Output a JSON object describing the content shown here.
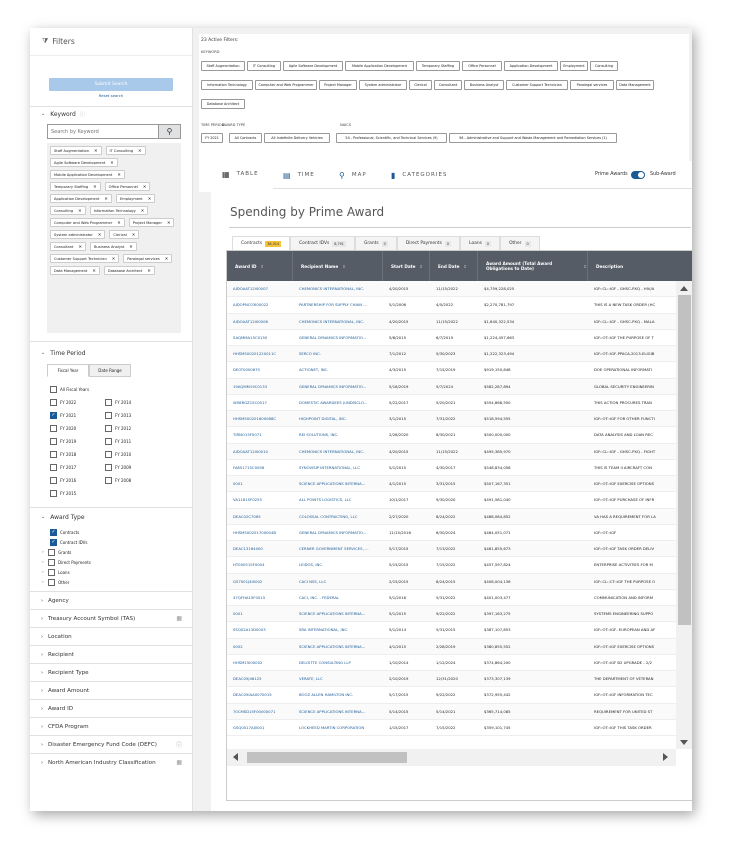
{
  "sidebar": {
    "title": "Filters",
    "submit_label": "Submit Search",
    "reset_label": "Reset search",
    "keyword": {
      "title": "Keyword",
      "placeholder": "Search by Keyword",
      "chips": [
        "Staff Augmentation",
        "IT Consulting",
        "Agile Software Development",
        "Mobile Application Development",
        "Temporary Staffing",
        "Office Personnel",
        "Application Development",
        "Employment",
        "Consulting",
        "Information Technology",
        "Computer and Web Programmer",
        "Project Manager",
        "System administrator",
        "Clerical",
        "Consultant",
        "Business Analyst",
        "Customer Support Technician",
        "Paralegal services",
        "Data Management",
        "Database Architect"
      ]
    },
    "time_period": {
      "title": "Time Period",
      "tab_fiscal": "Fiscal Year",
      "tab_range": "Date Range",
      "all_label": "All Fiscal Years",
      "years_left": [
        "FY 2022",
        "FY 2021",
        "FY 2020",
        "FY 2019",
        "FY 2018",
        "FY 2017",
        "FY 2016",
        "FY 2015"
      ],
      "years_right": [
        "FY 2014",
        "FY 2013",
        "FY 2012",
        "FY 2011",
        "FY 2010",
        "FY 2009",
        "FY 2008"
      ]
    },
    "award_type": {
      "title": "Award Type",
      "items": [
        "Contracts",
        "Contract IDVs",
        "Grants",
        "Direct Payments",
        "Loans",
        "Other"
      ]
    },
    "collapsed": [
      "Agency",
      "Treasury Account Symbol (TAS)",
      "Location",
      "Recipient",
      "Recipient Type",
      "Award Amount",
      "Award ID",
      "CFDA Program",
      "Disaster Emergency Fund Code (DEFC)",
      "North American Industry Classification"
    ]
  },
  "active_filters": {
    "title": "23 Active Filters:",
    "keyword_label": "KEYWORD",
    "row1": [
      "Staff Augmentation",
      "IT Consulting",
      "Agile Software Development",
      "Mobile Application Development",
      "Temporary Staffing",
      "Office Personnel",
      "Application Development",
      "Employment",
      "Consulting"
    ],
    "row2": [
      "Information Technology",
      "Computer and Web Programmer",
      "Project Manager",
      "System administrator",
      "Clerical",
      "Consultant",
      "Business Analyst",
      "Customer Support Technician",
      "Paralegal services",
      "Data Management"
    ],
    "row3": [
      "Database Architect"
    ],
    "time_label": "TIME PERIOD",
    "award_label": "AWARD TYPE",
    "naics_label": "NAICS",
    "time_chips": [
      "FY 2021"
    ],
    "award_chips": [
      "All Contracts",
      "All Indefinite Delivery Vehicles"
    ],
    "naics_chips": [
      "54 - Professional, Scientific, and Technical Services (9)",
      "56 - Administrative and Support and Waste Management and Remediation Services (1)"
    ]
  },
  "views": {
    "table": "TABLE",
    "time": "TIME",
    "map": "MAP",
    "categories": "CATEGORIES",
    "prime_awards": "Prime Awards",
    "sub_awards": "Sub-Award"
  },
  "section_title": "Spending by Prime Award",
  "award_tabs": [
    {
      "label": "Contracts",
      "count": "38,314"
    },
    {
      "label": "Contract IDVs",
      "count": "8,791"
    },
    {
      "label": "Grants",
      "count": "0"
    },
    {
      "label": "Direct Payments",
      "count": "0"
    },
    {
      "label": "Loans",
      "count": "0"
    },
    {
      "label": "Other",
      "count": "0"
    }
  ],
  "table": {
    "headers": [
      "Award ID",
      "Recipient Name",
      "Start Date",
      "End Date",
      "Award Amount (Total Award Obligations to Date)",
      "Description"
    ],
    "rows": [
      [
        "AIDOAAT12I00007",
        "CHEMONICS INTERNATIONAL, INC.",
        "4/20/2015",
        "11/15/2022",
        "$4,759,228,025",
        "IGF::CL::IGF - GHSC-PXQ - HIV/A"
      ],
      [
        "AIDOPNC03I00022",
        "PARTNERSHIP FOR SUPPLY CHAIN ...",
        "5/1/2006",
        "4/5/2022",
        "$2,270,781,797",
        "THIS IS A NEW TASK ORDER (HC"
      ],
      [
        "AIDOAAT12I00006",
        "CHEMONICS INTERNATIONAL, INC.",
        "4/20/2015",
        "11/15/2022",
        "$1,640,322,534",
        "IGF::CL::IGF - GHSC-PXQ - MALA"
      ],
      [
        "SAQMMA15C0150",
        "GENERAL DYNAMICS INFORMATIO...",
        "5/8/2015",
        "6/7/2019",
        "$1,224,457,663",
        "IGF::OT::IGF THE PURPOSE OF T"
      ],
      [
        "HHSM500201220011C",
        "SERCO INC.",
        "7/1/2012",
        "5/30/2023",
        "$1,222,323,494",
        "IGF::OT::IGF-PPACA-2013-ELIGIB"
      ],
      [
        "DE0T0000675",
        "ACTIONET, INC.",
        "4/3/2015",
        "7/15/2019",
        "$919,150,848",
        "DOE OPERATIONAL INFORMATI"
      ],
      [
        "19AQMM19C0133",
        "GENERAL DYNAMICS INFORMATIO...",
        "5/18/2019",
        "5/7/2024",
        "$582,287,894",
        "GLOBAL SECURITY ENGINEERIN"
      ],
      [
        "W58RGZ15C0017",
        "DOMESTIC AWARDEES (UNDISCLO...",
        "5/22/2017",
        "5/20/2021",
        "$554,868,550",
        "THIS ACTION PROCURES TRAN"
      ],
      [
        "HHSM500201600088C",
        "HIGHPOINT DIGITAL, INC.",
        "3/1/2015",
        "7/31/2022",
        "$518,594,555",
        "IGF::OT::IGF FOR OTHER FUNCTI"
      ],
      [
        "TIRNO15F0071",
        "REI SOLUTIONS, INC.",
        "2/28/2020",
        "8/30/2021",
        "$500,000,000",
        "DATA ANALYSIS AND LOAN REC"
      ],
      [
        "AIDOAAT12I00010",
        "CHEMONICS INTERNATIONAL, INC.",
        "4/20/2015",
        "11/15/2022",
        "$495,385,970",
        "IGF::CL::IGF - GHSC-PXQ - FIGHT"
      ],
      [
        "FA851715C0056",
        "SYNOVISIP INTERNATIONAL, LLC",
        "5/1/2015",
        "4/30/2017",
        "$548,834,058",
        "THIS IS TEAM II AIRCRAFT CON"
      ],
      [
        "0001",
        "SCIENCE APPLICATIONS INTERNA...",
        "4/1/2015",
        "3/31/2015",
        "$507,167,351",
        "IGF::OT::IGF EXERCISE OPTIONS"
      ],
      [
        "VA11815F0255",
        "ALL POINTS LOGISTICS, LLC",
        "10/1/2017",
        "9/30/2020",
        "$491,581,040",
        "IGF::OT::IGF PURCHASE OF INFR"
      ],
      [
        "DEAC02C7065",
        "COLOSSAL CONTRACTING, LLC",
        "2/27/2020",
        "8/24/2022",
        "$488,084,852",
        "VA HAS A REQUIREMENT FOR LA"
      ],
      [
        "HHSM500201700004B",
        "GENERAL DYNAMICS INFORMATIO...",
        "11/15/2016",
        "6/30/2024",
        "$484,051,071",
        "IGF::OT::IGF"
      ],
      [
        "DEAC13164000",
        "CERNER GOVERNMENT SERVICES, ...",
        "5/17/2015",
        "7/13/2022",
        "$481,855,673",
        "IGF::OT::IGF TASK ORDER DELIV"
      ],
      [
        "HT000515F0004",
        "LEIDOS, INC.",
        "5/15/2015",
        "7/15/2022",
        "$457,597,824",
        "ENTERPRISE ACTIVITIES FOR M"
      ],
      [
        "GS7001J4I0002",
        "CACI NSS, LLC",
        "2/15/2015",
        "8/24/2015",
        "$408,004,136",
        "IGF::CL::CT::IGF THE PURPOSE O"
      ],
      [
        "47QFHA15F0015",
        "CACI, INC. - FEDERAL",
        "5/1/2016",
        "5/31/2022",
        "$401,003,477",
        "COMMUNICATION AND INFORM"
      ],
      [
        "0001",
        "SCIENCE APPLICATIONS INTERNA...",
        "5/1/2015",
        "9/22/2022",
        "$397,163,275",
        "SYSTEMS ENGINEERING SUPPO"
      ],
      [
        "SSQ02A13D0003",
        "SRA INTERNATIONAL, INC.",
        "5/1/2014",
        "5/31/2015",
        "$387,107,853",
        "IGF::OT::IGF- EUROPEAN AND AF"
      ],
      [
        "0002",
        "SCIENCE APPLICATIONS INTERNA...",
        "4/1/2015",
        "2/28/2019",
        "$380,855,552",
        "IGF::OT::IGF EXERCISE OPTIONS"
      ],
      [
        "HHSM15I00002",
        "DELOITTE CONSULTING LLP",
        "1/10/2014",
        "1/12/2024",
        "$374,864,200",
        "IGF::OT::IGF B2 UPGRADE - 2/2"
      ],
      [
        "DEAC05J46125",
        "VERATE, LLC",
        "2/10/2019",
        "12/31/2020",
        "$373,307,139",
        "THE DEPARTMENT OF VETERAN"
      ],
      [
        "DEAC05IAA0070015",
        "BOOZ ALLEN HAMILTON INC.",
        "5/17/2015",
        "9/22/2022",
        "$372,955,442",
        "IGF::OT::IGF INFORMATION TEC"
      ],
      [
        "70CMSD15F00000071",
        "SCIENCE APPLICATIONS INTERNA...",
        "5/14/2015",
        "5/14/2021",
        "$365,714,085",
        "REQUIREMENT FOR UNITED ST"
      ],
      [
        "GSQ0017AJ0001",
        "LOCKHEED MARTIN CORPORATION",
        "1/15/2017",
        "7/15/2022",
        "$359,101,745",
        "IGF::OT::IGF THIS TASK ORDER"
      ]
    ]
  }
}
